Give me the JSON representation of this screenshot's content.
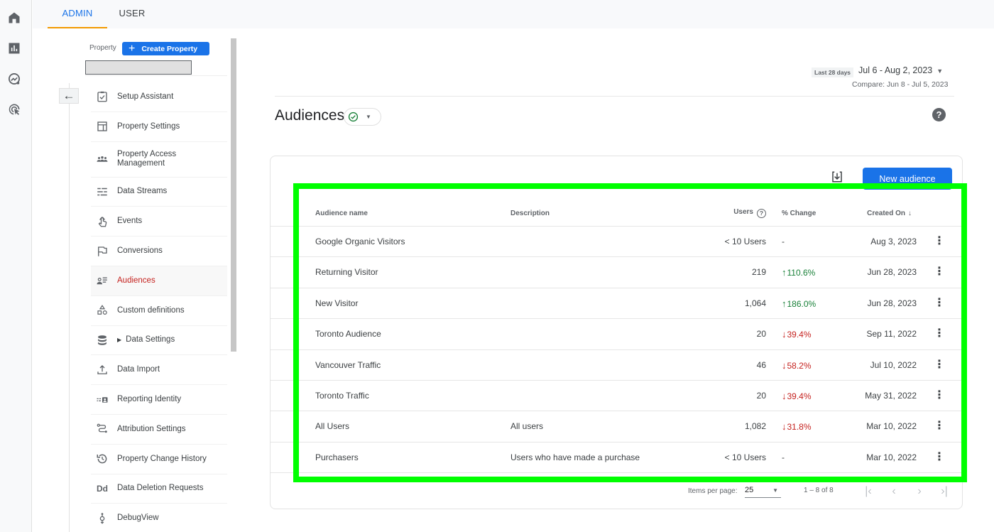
{
  "rail": {
    "items": [
      {
        "name": "home",
        "icon": "home-icon"
      },
      {
        "name": "reports",
        "icon": "bar-chart-icon"
      },
      {
        "name": "explore",
        "icon": "explore-icon"
      },
      {
        "name": "advertising",
        "icon": "advertising-icon"
      }
    ]
  },
  "tabs": [
    {
      "label": "ADMIN",
      "active": true
    },
    {
      "label": "USER",
      "active": false
    }
  ],
  "admin": {
    "property_label": "Property",
    "create_property_label": "Create Property",
    "property_selector_value": "",
    "nav": [
      {
        "label": "Setup Assistant",
        "icon": "setup-assistant-icon"
      },
      {
        "label": "Property Settings",
        "icon": "property-settings-icon"
      },
      {
        "label": "Property Access Management",
        "icon": "access-management-icon"
      },
      {
        "label": "Data Streams",
        "icon": "data-streams-icon"
      },
      {
        "label": "Events",
        "icon": "events-icon"
      },
      {
        "label": "Conversions",
        "icon": "conversions-flag-icon"
      },
      {
        "label": "Audiences",
        "icon": "audiences-icon",
        "active": true
      },
      {
        "label": "Custom definitions",
        "icon": "custom-definitions-icon"
      },
      {
        "label": "Data Settings",
        "icon": "data-settings-icon",
        "expandable": true
      },
      {
        "label": "Data Import",
        "icon": "data-import-icon"
      },
      {
        "label": "Reporting Identity",
        "icon": "reporting-identity-icon"
      },
      {
        "label": "Attribution Settings",
        "icon": "attribution-settings-icon"
      },
      {
        "label": "Property Change History",
        "icon": "change-history-icon"
      },
      {
        "label": "Data Deletion Requests",
        "icon": "data-deletion-icon"
      },
      {
        "label": "DebugView",
        "icon": "debugview-icon"
      }
    ]
  },
  "date": {
    "chip": "Last 28 days",
    "range": "Jul 6 - Aug 2, 2023",
    "compare": "Compare: Jun 8 - Jul 5, 2023"
  },
  "page": {
    "title": "Audiences",
    "status": "ok",
    "help": "?"
  },
  "toolbar": {
    "export_icon": "export-download-icon",
    "new_audience_label": "New audience"
  },
  "table": {
    "columns": {
      "name": "Audience name",
      "description": "Description",
      "users": "Users",
      "change": "% Change",
      "created": "Created On"
    },
    "rows": [
      {
        "name": "Google Organic Visitors",
        "description": "",
        "users": "< 10 Users",
        "change": "-",
        "direction": "none",
        "created": "Aug 3, 2023"
      },
      {
        "name": "Returning Visitor",
        "description": "",
        "users": "219",
        "change": "110.6%",
        "direction": "up",
        "created": "Jun 28, 2023"
      },
      {
        "name": "New Visitor",
        "description": "",
        "users": "1,064",
        "change": "186.0%",
        "direction": "up",
        "created": "Jun 28, 2023"
      },
      {
        "name": "Toronto Audience",
        "description": "",
        "users": "20",
        "change": "39.4%",
        "direction": "down",
        "created": "Sep 11, 2022"
      },
      {
        "name": "Vancouver Traffic",
        "description": "",
        "users": "46",
        "change": "58.2%",
        "direction": "down",
        "created": "Jul 10, 2022"
      },
      {
        "name": "Toronto Traffic",
        "description": "",
        "users": "20",
        "change": "39.4%",
        "direction": "down",
        "created": "May 31, 2022"
      },
      {
        "name": "All Users",
        "description": "All users",
        "users": "1,082",
        "change": "31.8%",
        "direction": "down",
        "created": "Mar 10, 2022"
      },
      {
        "name": "Purchasers",
        "description": "Users who have made a purchase",
        "users": "< 10 Users",
        "change": "-",
        "direction": "none",
        "created": "Mar 10, 2022"
      }
    ]
  },
  "pager": {
    "items_per_page_label": "Items per page:",
    "items_per_page": "25",
    "range": "1 – 8 of 8"
  },
  "colors": {
    "accent": "#1a73e8",
    "active_tab_underline": "#f29900",
    "active_nav": "#c5221f",
    "positive": "#188038",
    "negative": "#c5221f",
    "highlight_box": "#00ff00"
  }
}
